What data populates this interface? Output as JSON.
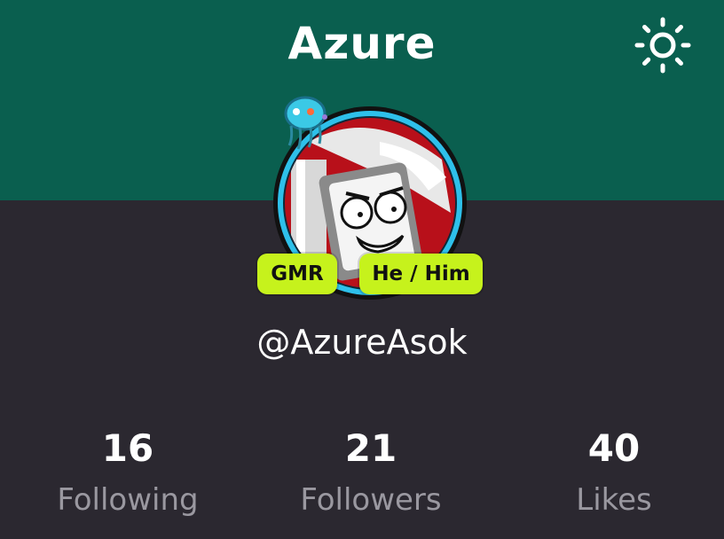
{
  "header": {
    "title": "Azure",
    "theme_toggle_icon": "sun-icon"
  },
  "profile": {
    "avatar_icon": "robot-avatar",
    "badges": [
      "GMR",
      "He / Him"
    ],
    "username": "@AzureAsok"
  },
  "stats": [
    {
      "value": "16",
      "label": "Following"
    },
    {
      "value": "21",
      "label": "Followers"
    },
    {
      "value": "40",
      "label": "Likes"
    }
  ],
  "colors": {
    "header_bg": "#0a5f4f",
    "body_bg": "#2b2830",
    "badge_bg": "#c6f21c",
    "avatar_ring": "#2ec0ea"
  }
}
